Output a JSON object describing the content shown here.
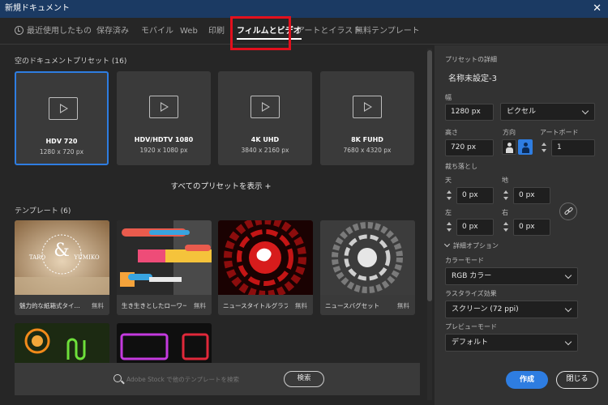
{
  "window": {
    "title": "新規ドキュメント",
    "close_glyph": "✕"
  },
  "tabs": [
    {
      "label": "最近使用したもの",
      "icon": "clock-icon",
      "active": false
    },
    {
      "label": "保存済み",
      "active": false
    },
    {
      "label": "モバイル",
      "active": false
    },
    {
      "label": "Web",
      "active": false
    },
    {
      "label": "印刷",
      "active": false
    },
    {
      "label": "フィルムとビデオ",
      "active": true
    },
    {
      "label": "アートとイラスト",
      "active": false
    },
    {
      "label": "無料テンプレート",
      "active": false
    }
  ],
  "highlight_color": "#e3101d",
  "accent_color": "#2e7de1",
  "presets": {
    "section_title": "空のドキュメントプリセット (16)",
    "items": [
      {
        "name": "HDV 720",
        "size": "1280 x 720 px",
        "selected": true
      },
      {
        "name": "HDV/HDTV 1080",
        "size": "1920 x 1080 px",
        "selected": false
      },
      {
        "name": "4K UHD",
        "size": "3840 x 2160 px",
        "selected": false
      },
      {
        "name": "8K FUHD",
        "size": "7680 x 4320 px",
        "selected": false
      }
    ],
    "show_all": "すべてのプリセットを表示 +"
  },
  "templates": {
    "section_title": "テンプレート (6)",
    "items": [
      {
        "title": "魅力的な紙箱式タイ...",
        "badge": "無料"
      },
      {
        "title": "生き生きとしたローワー...",
        "badge": "無料"
      },
      {
        "title": "ニュースタイトルグラフィ...",
        "badge": "無料"
      },
      {
        "title": "ニュースバグセット",
        "badge": "無料"
      }
    ],
    "thumb_text": {
      "couple_left": "TARO",
      "couple_right": "YUMIKO",
      "ampersand": "&"
    }
  },
  "search": {
    "placeholder": "Adobe Stock で他のテンプレートを検索",
    "button": "検索"
  },
  "details": {
    "section_title": "プリセットの詳細",
    "doc_name": "名称未設定-3",
    "width_label": "幅",
    "width_value": "1280 px",
    "unit": "ピクセル",
    "height_label": "高さ",
    "height_value": "720 px",
    "orientation_label": "方向",
    "artboard_label": "アートボード",
    "artboard_value": "1",
    "bleed_label": "裁ち落とし",
    "top_label": "天",
    "top_value": "0 px",
    "bottom_label": "地",
    "bottom_value": "0 px",
    "left_label": "左",
    "left_value": "0 px",
    "right_label": "右",
    "right_value": "0 px",
    "advanced_label": "詳細オプション",
    "color_mode_label": "カラーモード",
    "color_mode_value": "RGB カラー",
    "raster_label": "ラスタライズ効果",
    "raster_value": "スクリーン (72 ppi)",
    "preview_label": "プレビューモード",
    "preview_value": "デフォルト"
  },
  "actions": {
    "create": "作成",
    "close": "閉じる"
  }
}
